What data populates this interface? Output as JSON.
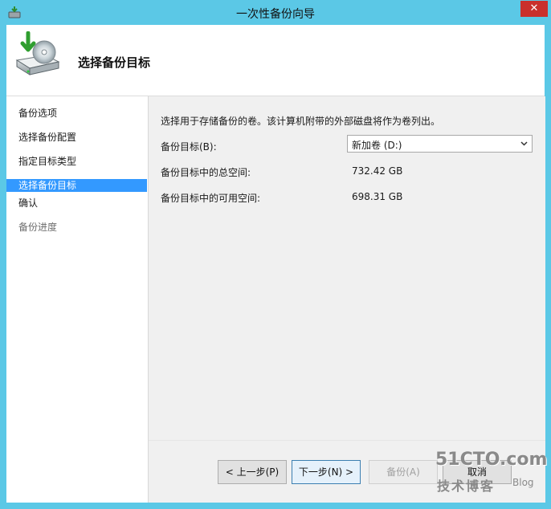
{
  "window": {
    "title": "一次性备份向导",
    "close_glyph": "✕"
  },
  "header": {
    "title": "选择备份目标",
    "icon": "backup-drive-icon"
  },
  "nav": {
    "items": [
      {
        "label": "备份选项",
        "state": "normal"
      },
      {
        "label": "选择备份配置",
        "state": "normal"
      },
      {
        "label": "指定目标类型",
        "state": "normal"
      },
      {
        "label": "选择备份目标",
        "state": "selected"
      },
      {
        "label": "确认",
        "state": "normal"
      },
      {
        "label": "备份进度",
        "state": "disabled"
      }
    ]
  },
  "content": {
    "description": "选择用于存储备份的卷。该计算机附带的外部磁盘将作为卷列出。",
    "target_label": "备份目标(B):",
    "target_value": "新加卷 (D:)",
    "total_label": "备份目标中的总空间:",
    "total_value": "732.42 GB",
    "free_label": "备份目标中的可用空间:",
    "free_value": "698.31 GB"
  },
  "buttons": {
    "prev": "< 上一步(P)",
    "next": "下一步(N) >",
    "backup": "备份(A)",
    "cancel": "取消"
  },
  "watermark": {
    "site": "51CTO.com",
    "cn": "技术博客",
    "blog": "Blog"
  },
  "colors": {
    "titlebar": "#5bc8e6",
    "selection": "#3399ff",
    "close": "#c9302c"
  }
}
